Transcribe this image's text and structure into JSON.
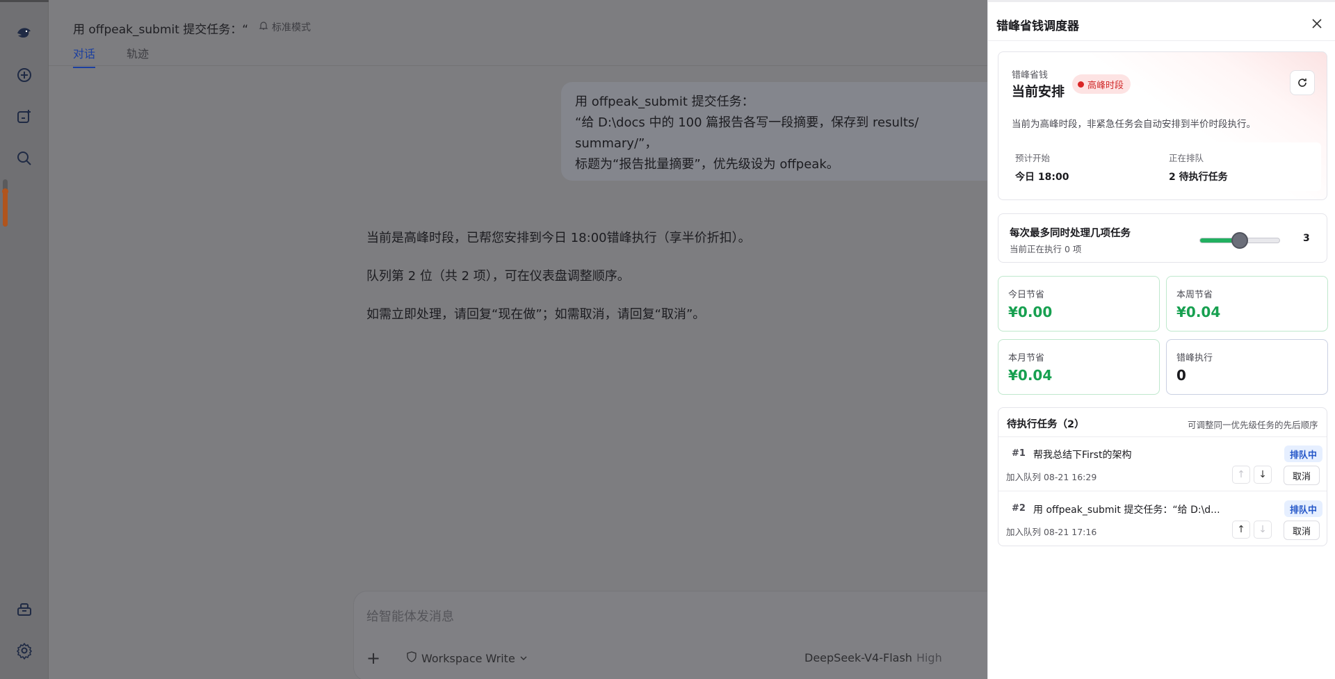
{
  "header": {
    "title": "用 offpeak_submit 提交任务：“",
    "mode": "标准模式",
    "tabs": [
      {
        "label": "对话",
        "active": true
      },
      {
        "label": "轨迹",
        "active": false
      }
    ]
  },
  "rail": {
    "icons": [
      "whale-logo-icon",
      "new-chat-icon",
      "new-item-icon",
      "search-icon",
      "tools-icon",
      "gear-icon"
    ],
    "temperature_level": 0.75
  },
  "conversation": {
    "user_message_lines": [
      "用 offpeak_submit 提交任务：",
      "“给 D:\\docs 中的 100 篇报告各写一段摘要，保存到 results/",
      "summary/”，",
      "标题为“报告批量摘要”，优先级设为 offpeak。"
    ],
    "assistant_paragraphs": [
      "当前是高峰时段，已帮您安排到今日 18:00错峰执行（享半价折扣）。",
      "队列第 2 位（共 2 项），可在仪表盘调整顺序。",
      "如需立即处理，请回复“现在做”；如需取消，请回复“取消”。"
    ]
  },
  "composer": {
    "placeholder": "给智能体发消息",
    "plus": "+",
    "workspace": "Workspace Write",
    "model": "DeepSeek-V4-Flash",
    "effort": "High"
  },
  "panel": {
    "title": "错峰省钱调度器",
    "schedule": {
      "eyebrow": "错峰省钱",
      "heading": "当前安排",
      "badge": "高峰时段",
      "description": "当前为高峰时段，非紧急任务会自动安排到半价时段执行。",
      "start_label": "预计开始",
      "start_value": "今日 18:00",
      "queue_label": "正在排队",
      "queue_value": "2 待执行任务"
    },
    "concurrency": {
      "title": "每次最多同时处理几项任务",
      "subtitle": "当前正在执行 0 项",
      "value": "3",
      "min": 1,
      "max": 5,
      "level": 3
    },
    "stats": [
      {
        "label": "今日节省",
        "value": "¥0.00",
        "accent": true
      },
      {
        "label": "本周节省",
        "value": "¥0.04",
        "accent": true
      },
      {
        "label": "本月节省",
        "value": "¥0.04",
        "accent": true
      },
      {
        "label": "错峰执行",
        "value": "0",
        "accent": false
      }
    ],
    "queue": {
      "title": "待执行任务（2）",
      "hint": "可调整同一优先级任务的先后顺序",
      "items": [
        {
          "index": "#1",
          "name": "帮我总结下First的架构",
          "status": "排队中",
          "time": "加入队列 08-21 16:29",
          "cancel": "取消",
          "up": "↑",
          "down": "↓"
        },
        {
          "index": "#2",
          "name": "用 offpeak_submit 提交任务：“给 D:\\d...",
          "status": "排队中",
          "time": "加入队列 08-21 17:16",
          "cancel": "取消",
          "up": "↑",
          "down": "↓"
        }
      ]
    }
  }
}
